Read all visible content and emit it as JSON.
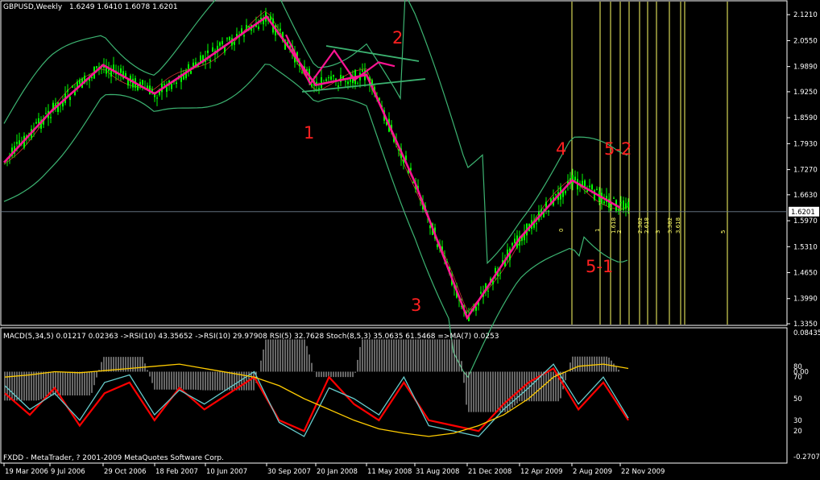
{
  "chart_header": {
    "symbol": "GBPUSD,Weekly",
    "ohlc": "1.6249 1.6410 1.6078 1.6201"
  },
  "indicator_header": "MACD(5,34,5) 0.01217 0.02363  ->RSI(10) 43.35652  ->RSI(10) 29.97908  RSI(5) 32.7628  Stoch(8,5,3) 35.0635 61.5468  =>MA(7) 0.0253",
  "footer_text": "FXDD - MetaTrader, ? 2001-2009 MetaQuotes Software Corp.",
  "colors": {
    "background": "#000000",
    "candle": "#00ff00",
    "zigzag": "#ff1493",
    "bands": "#3cb371",
    "wave_labels": "#ff2020",
    "fib_lines": "#ffff66",
    "rsi": "#ff0000",
    "stoch": "#66cccc",
    "ma_yellow": "#ffcc00",
    "ma_orange": "#ff8800"
  },
  "wave_labels": [
    "1",
    "2",
    "3",
    "4",
    "5-1",
    "5-2"
  ],
  "fib_time_labels": [
    "1.618",
    "2",
    "2.382",
    "2.618",
    "3",
    "3.382",
    "3.618",
    "5"
  ],
  "fib_small_labels": [
    "0",
    "1"
  ],
  "chart_data": [
    {
      "type": "line",
      "title": "GBPUSD,Weekly",
      "x": [
        "19 Mar 2006",
        "9 Jul 2006",
        "29 Oct 2006",
        "18 Feb 2007",
        "10 Jun 2007",
        "30 Sep 2007",
        "20 Jan 2008",
        "11 May 2008",
        "31 Aug 2008",
        "21 Dec 2008",
        "12 Apr 2009",
        "2 Aug 2009",
        "22 Nov 2009"
      ],
      "ylim": [
        1.335,
        2.146
      ],
      "y_ticks": [
        "2.1210",
        "2.0550",
        "1.9890",
        "1.9250",
        "1.8590",
        "1.7930",
        "1.7270",
        "1.6630",
        "1.5970",
        "1.5310",
        "1.4650",
        "1.3990",
        "1.3350"
      ],
      "current_price": "1.6201",
      "series": [
        {
          "name": "ZigZag",
          "points": [
            {
              "x": "19 Mar 2006",
              "y": 1.745
            },
            {
              "x": "9 Jul 2006",
              "y": 1.872
            },
            {
              "x": "29 Oct 2006",
              "y": 1.993
            },
            {
              "x": "18 Feb 2007",
              "y": 1.92
            },
            {
              "x": "10 Jun 2007",
              "y": 2.007
            },
            {
              "x": "30 Sep 2007",
              "y": 2.116
            },
            {
              "x": "20 Jan 2008",
              "y": 1.942
            },
            {
              "x": "11 May 2008",
              "y": 1.968
            },
            {
              "x": "31 Aug 2008",
              "y": 1.695
            },
            {
              "x": "21 Dec 2008",
              "y": 1.35
            },
            {
              "x": "12 Apr 2009",
              "y": 1.552
            },
            {
              "x": "2 Aug 2009",
              "y": 1.7
            },
            {
              "x": "22 Nov 2009",
              "y": 1.63
            }
          ]
        }
      ],
      "grid": false,
      "legend": "none"
    },
    {
      "type": "line",
      "title": "",
      "y_ticks": [
        "0.08435",
        "0.00",
        "-0.2707"
      ],
      "level_ticks": [
        "80",
        "70",
        "50",
        "30",
        "20"
      ],
      "series": [
        {
          "name": "RSI(10)",
          "values": [
            55,
            35,
            60,
            25,
            55,
            65,
            30,
            60,
            40,
            55,
            70,
            30,
            20,
            70,
            45,
            30,
            65,
            30,
            25,
            20,
            45,
            65,
            78,
            40,
            65,
            30
          ]
        },
        {
          "name": "Stoch(8,5,3)",
          "values": [
            62,
            40,
            55,
            30,
            65,
            72,
            35,
            58,
            45,
            60,
            75,
            28,
            15,
            60,
            50,
            35,
            70,
            25,
            20,
            15,
            40,
            60,
            82,
            45,
            70,
            32
          ]
        },
        {
          "name": "MA(7)",
          "values": [
            70,
            72,
            75,
            74,
            76,
            78,
            80,
            82,
            78,
            74,
            70,
            62,
            50,
            40,
            30,
            22,
            18,
            15,
            18,
            25,
            35,
            50,
            70,
            80,
            82,
            78
          ]
        }
      ],
      "grid": false,
      "legend": "none"
    }
  ]
}
